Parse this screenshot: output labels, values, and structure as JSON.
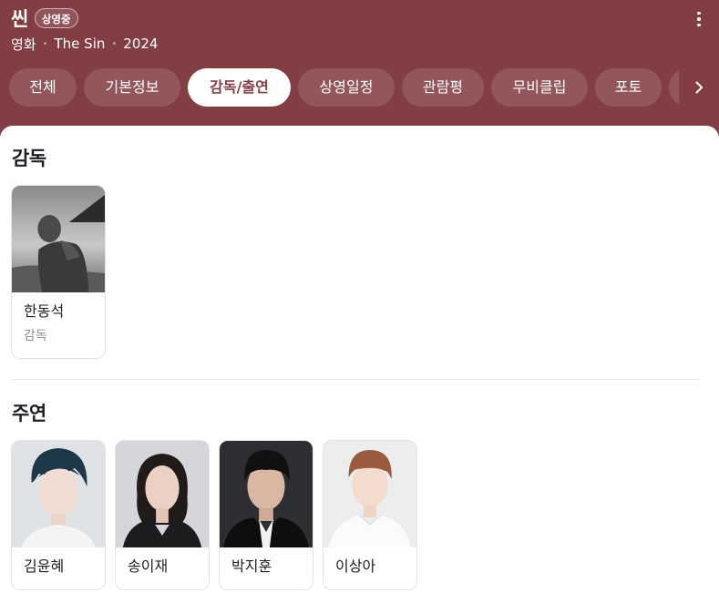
{
  "header": {
    "title": "씬",
    "badge": "상영중",
    "category": "영화",
    "english_title": "The Sin",
    "year": "2024",
    "bg_color": "#833e43"
  },
  "tabs": [
    {
      "label": "전체"
    },
    {
      "label": "기본정보"
    },
    {
      "label": "감독/출연",
      "active": true
    },
    {
      "label": "상영일정"
    },
    {
      "label": "관람평"
    },
    {
      "label": "무비클립"
    },
    {
      "label": "포토"
    },
    {
      "label": ""
    }
  ],
  "director_section": {
    "title": "감독",
    "people": [
      {
        "name": "한동석",
        "role": "감독"
      }
    ]
  },
  "cast_section": {
    "title": "주연",
    "people": [
      {
        "name": "김윤혜"
      },
      {
        "name": "송이재"
      },
      {
        "name": "박지훈"
      },
      {
        "name": "이상아"
      }
    ]
  }
}
